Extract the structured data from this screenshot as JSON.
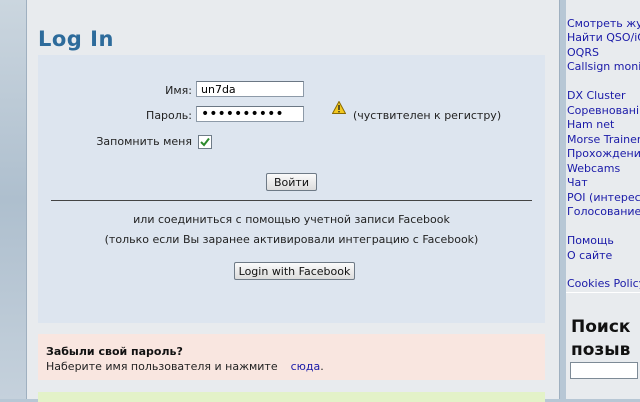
{
  "page": {
    "title": "Log In"
  },
  "form": {
    "username_label": "Имя:",
    "username_value": "un7da",
    "password_label": "Пароль:",
    "password_value": "••••••••••",
    "case_note": "(чуствителен к регистру)",
    "remember_label": "Запомнить меня",
    "remember_checked": true,
    "submit_label": "Войти",
    "fb_text_1": "или соединиться с помощью учетной записи Facebook",
    "fb_text_2": "(только если Вы заранее активировали интеграцию с Facebook)",
    "fb_button": "Login with Facebook"
  },
  "forgot": {
    "heading": "Забыли свой пароль?",
    "text": "Наберите имя пользователя и нажмите",
    "link": "сюда",
    "dot": "."
  },
  "sidebar": {
    "group1": [
      "Смотреть жур",
      "Найти QSO/iQ",
      "OQRS",
      "Callsign monit"
    ],
    "group2": [
      "DX Cluster",
      "Соревновані",
      "Ham net",
      "Morse Trainer",
      "Прохождение",
      "Webcams",
      "Чат",
      "POI (интерес",
      "Голосование"
    ],
    "group3": [
      "Помощь",
      "О сайте"
    ],
    "group4": [
      "Cookies Policy"
    ],
    "search_title_1": "Поиск",
    "search_title_2": "позыв"
  },
  "colors": {
    "title": "#2d6b9b",
    "link": "#1a1aa8",
    "formbox": "#dde5ef",
    "forgot_bg": "#f9e6e0"
  }
}
